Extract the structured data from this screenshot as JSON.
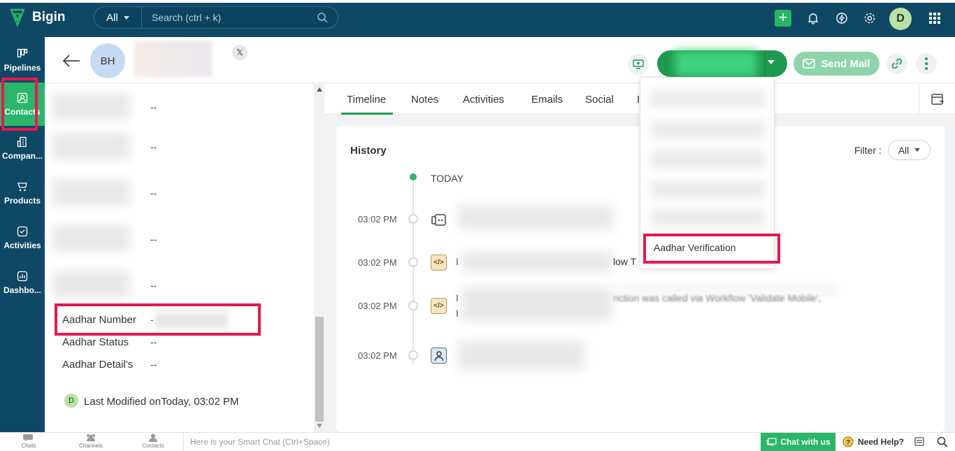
{
  "app": {
    "name": "Bigin"
  },
  "search": {
    "filter": "All",
    "placeholder": "Search (ctrl + k)"
  },
  "topbar": {
    "user_initial": "D"
  },
  "nav": [
    {
      "label": "Pipelines",
      "icon": "pipelines-icon"
    },
    {
      "label": "Contacts",
      "icon": "contacts-icon",
      "active": true
    },
    {
      "label": "Compan...",
      "icon": "companies-icon"
    },
    {
      "label": "Products",
      "icon": "products-icon"
    },
    {
      "label": "Activities",
      "icon": "activities-icon"
    },
    {
      "label": "Dashbo...",
      "icon": "dashboards-icon"
    }
  ],
  "contact": {
    "initials": "BH",
    "x_label": "𝕏"
  },
  "actions": {
    "send_mail": "Send Mail"
  },
  "fields": {
    "placeholder_values": [
      "--",
      "--",
      "--",
      "--",
      "--"
    ],
    "aadhar_number_label": "Aadhar Number",
    "aadhar_number_dash": "-",
    "aadhar_status_label": "Aadhar Status",
    "aadhar_status_value": "--",
    "aadhar_details_label": "Aadhar Detail's",
    "aadhar_details_value": "--"
  },
  "last_modified": {
    "avatar": "D",
    "prefix": "Last Modified on",
    "value": "Today, 03:02 PM"
  },
  "tabs": [
    "Timeline",
    "Notes",
    "Activities",
    "Emails",
    "Social",
    "I"
  ],
  "history": {
    "title": "History",
    "filter_label": "Filter :",
    "filter_value": "All",
    "today_label": "TODAY",
    "entries": [
      {
        "time": "03:02 PM",
        "icon": "chat-bubble-icon",
        "text": ""
      },
      {
        "time": "03:02 PM",
        "icon": "code-icon",
        "icon_glyph": "</>",
        "text_start": "I",
        "text_end": "low T"
      },
      {
        "time": "03:02 PM",
        "icon": "code-icon",
        "icon_glyph": "</>",
        "text_start": "I",
        "text_end": "nction was called via Workflow 'Validate Mobile',",
        "text_line2": "I"
      },
      {
        "time": "03:02 PM",
        "icon": "user-icon",
        "text": ""
      }
    ]
  },
  "dropdown": {
    "highlighted_item": "Aadhar Verification"
  },
  "bottombar": {
    "items": [
      "Chats",
      "Channels",
      "Contacts"
    ],
    "smart_chat_placeholder": "Here is your Smart Chat (Ctrl+Space)",
    "chat_with_us": "Chat with us",
    "need_help": "Need Help?"
  },
  "colors": {
    "topbar": "#0e4864",
    "accent": "#2ab66a",
    "highlight": "#e8174f"
  }
}
